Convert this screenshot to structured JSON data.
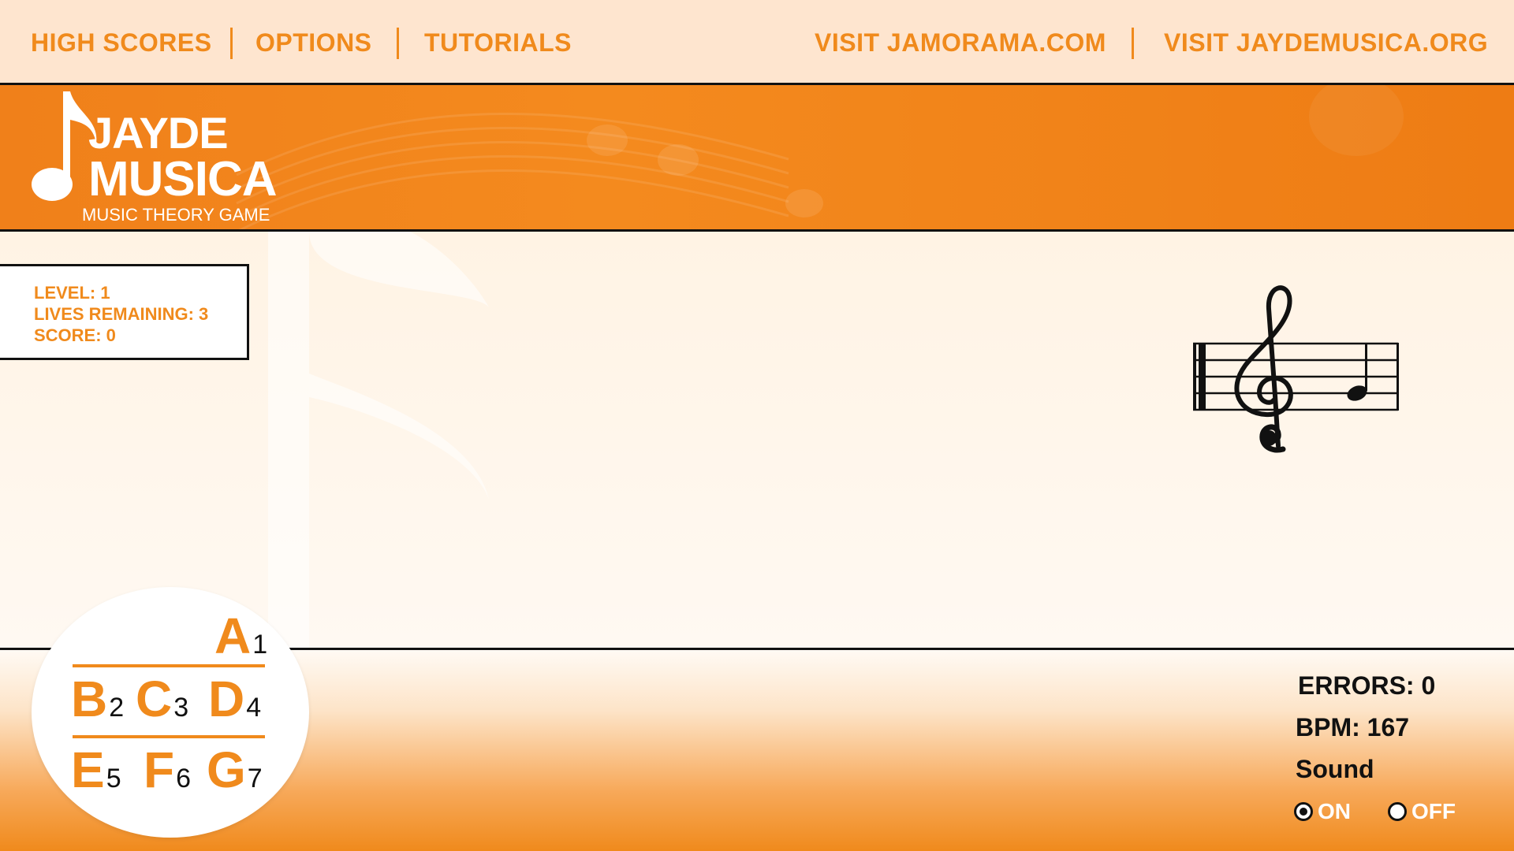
{
  "nav": {
    "high_scores": "HIGH SCORES",
    "options": "OPTIONS",
    "tutorials": "TUTORIALS",
    "visit_jamorama": "VISIT JAMORAMA.COM",
    "visit_jaydemusica": "VISIT JAYDEMUSICA.ORG"
  },
  "logo": {
    "line1": "JAYDE",
    "line2": "MUSICA",
    "tagline": "MUSIC THEORY GAME"
  },
  "status": {
    "level": "LEVEL: 1",
    "lives": "LIVES REMAINING: 3",
    "score": "SCORE: 0"
  },
  "keys": [
    {
      "letter": "A",
      "number": "1"
    },
    {
      "letter": "B",
      "number": "2"
    },
    {
      "letter": "C",
      "number": "3"
    },
    {
      "letter": "D",
      "number": "4"
    },
    {
      "letter": "E",
      "number": "5"
    },
    {
      "letter": "F",
      "number": "6"
    },
    {
      "letter": "G",
      "number": "7"
    }
  ],
  "hud": {
    "errors": "ERRORS: 0",
    "bpm": "BPM: 167",
    "sound_label": "Sound",
    "sound_on": "ON",
    "sound_off": "OFF",
    "sound_selected": "ON"
  },
  "colors": {
    "accent": "#f08a1c",
    "text_dark": "#111111"
  },
  "icons": [
    "music-note-logo-icon",
    "treble-clef-icon",
    "quarter-note-icon",
    "radio-selected-icon",
    "radio-unselected-icon"
  ]
}
